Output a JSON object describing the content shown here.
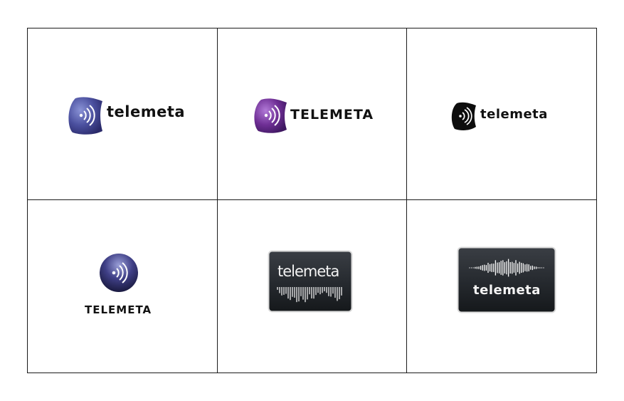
{
  "logos": [
    {
      "wordmark": "telemeta",
      "variant": "purple-badge-lowercase"
    },
    {
      "wordmark": "TELEMETA",
      "variant": "violet-badge-uppercase"
    },
    {
      "wordmark": "telemeta",
      "variant": "black-badge-lowercase"
    },
    {
      "wordmark": "TELEMETA",
      "variant": "circle-badge-stacked"
    },
    {
      "wordmark": "telemeta",
      "variant": "dark-box-thin-wordmark-waveform"
    },
    {
      "wordmark": "telemeta",
      "variant": "dark-box-waveform-bold-wordmark"
    }
  ],
  "colors": {
    "badge_blue": "#3b3f8f",
    "badge_violet": "#6a2b8e",
    "badge_black": "#0d0d0d",
    "box_dark": "#1f2226",
    "grid_line": "#1a1a1a"
  },
  "icons": [
    "sound-waves-icon",
    "waveform-icon"
  ]
}
